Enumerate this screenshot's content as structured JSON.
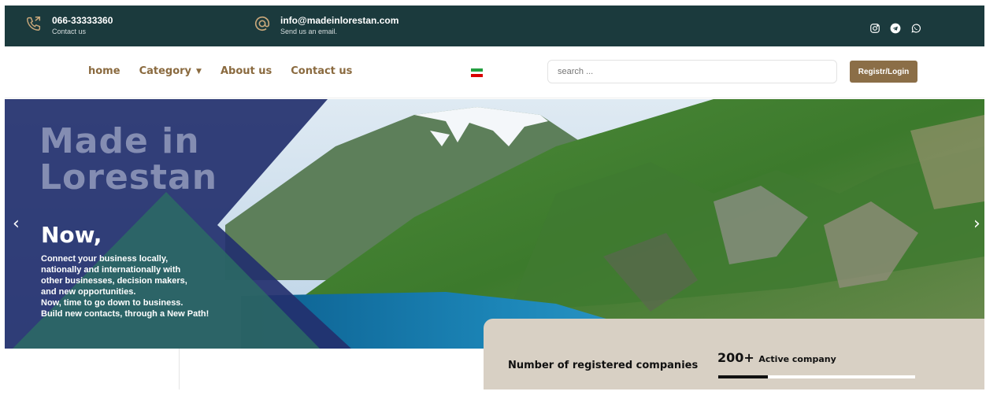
{
  "topbar": {
    "phone": {
      "main": "066-33333360",
      "sub": "Contact us",
      "icon": "phone-icon"
    },
    "email": {
      "main": "info@madeinlorestan.com",
      "sub": "Send us an email.",
      "icon": "at-icon"
    },
    "socials": [
      "instagram-icon",
      "telegram-icon",
      "whatsapp-icon"
    ]
  },
  "nav": {
    "items": [
      {
        "label": "home"
      },
      {
        "label": "Category"
      },
      {
        "label": "About us"
      },
      {
        "label": "Contact us"
      }
    ],
    "flag_colors": [
      "#239f40",
      "#ffffff",
      "#da0000"
    ],
    "search_placeholder": "search ...",
    "login_label": "Registr/Login"
  },
  "hero": {
    "title_line1": "Made in",
    "title_line2": "Lorestan",
    "headline": "Now,",
    "description": [
      "Connect your business locally,",
      "nationally and internationally with",
      "other businesses, decision makers,",
      "and new opportunities.",
      "Now, time to go down to business.",
      "Build new contacts, through a New Path!"
    ],
    "prev_arrow": "‹",
    "next_arrow": "›"
  },
  "stats": {
    "label": "Number of registered companies",
    "count": "200+",
    "count_suffix": "Active company",
    "progress": 0.25
  },
  "colors": {
    "topbar_bg": "#1b3a3d",
    "accent_brown": "#8b6e47",
    "nav_text": "#8a6a3f",
    "stats_bg": "#d8d0c4",
    "overlay_blue": "#23306e"
  }
}
